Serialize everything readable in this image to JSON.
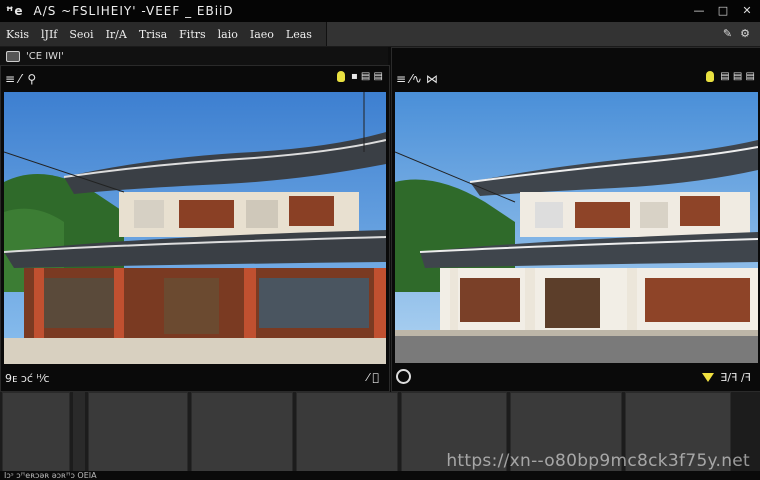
{
  "titlebar": {
    "logo": "ꟸe",
    "title": "A/S  ~FSLIHEIY' -VEEF  _  EBiiD"
  },
  "window_controls": {
    "minimize": "—",
    "maximize": "□",
    "close": "✕"
  },
  "menubar": {
    "items": [
      "Ksis",
      "lJIf",
      "Seoi",
      "Ir/A",
      "Trisa",
      "Fitrs",
      "laio",
      "Iaeo",
      "Leas"
    ],
    "right_icons": [
      "wrench-icon",
      "gear-icon"
    ]
  },
  "left_panel": {
    "header_label": "'CE IWI'",
    "toolbar_left": "≡  ⁄′  ⚲",
    "toolbar_right": "▪ ▤ ▤",
    "footer_left": "9ᴇ  ɔᴄ́ ᴴ⁄ᴄ",
    "footer_right": "⁄ ⃝"
  },
  "right_panel": {
    "toolbar_left": "≡  ⁄∿ ⋈",
    "toolbar_right": "▤ ▤ ▤",
    "footer_right": "Ǝ/ꟻ  ∕ꟻ"
  },
  "thumbnails": {
    "count": 7
  },
  "statusbar": {
    "items": [
      "Iɔˢ  ɔꟸeʀɔǝʀ  ǝɔʀꟸɔ  OEIA"
    ]
  },
  "watermark": "https://xn--o80bp9mc8ck3f75y.net",
  "colors": {
    "sky": "#4a8fd8",
    "roof": "#3a3f45",
    "pillar": "#c05030",
    "accent_yellow": "#f0e040"
  }
}
